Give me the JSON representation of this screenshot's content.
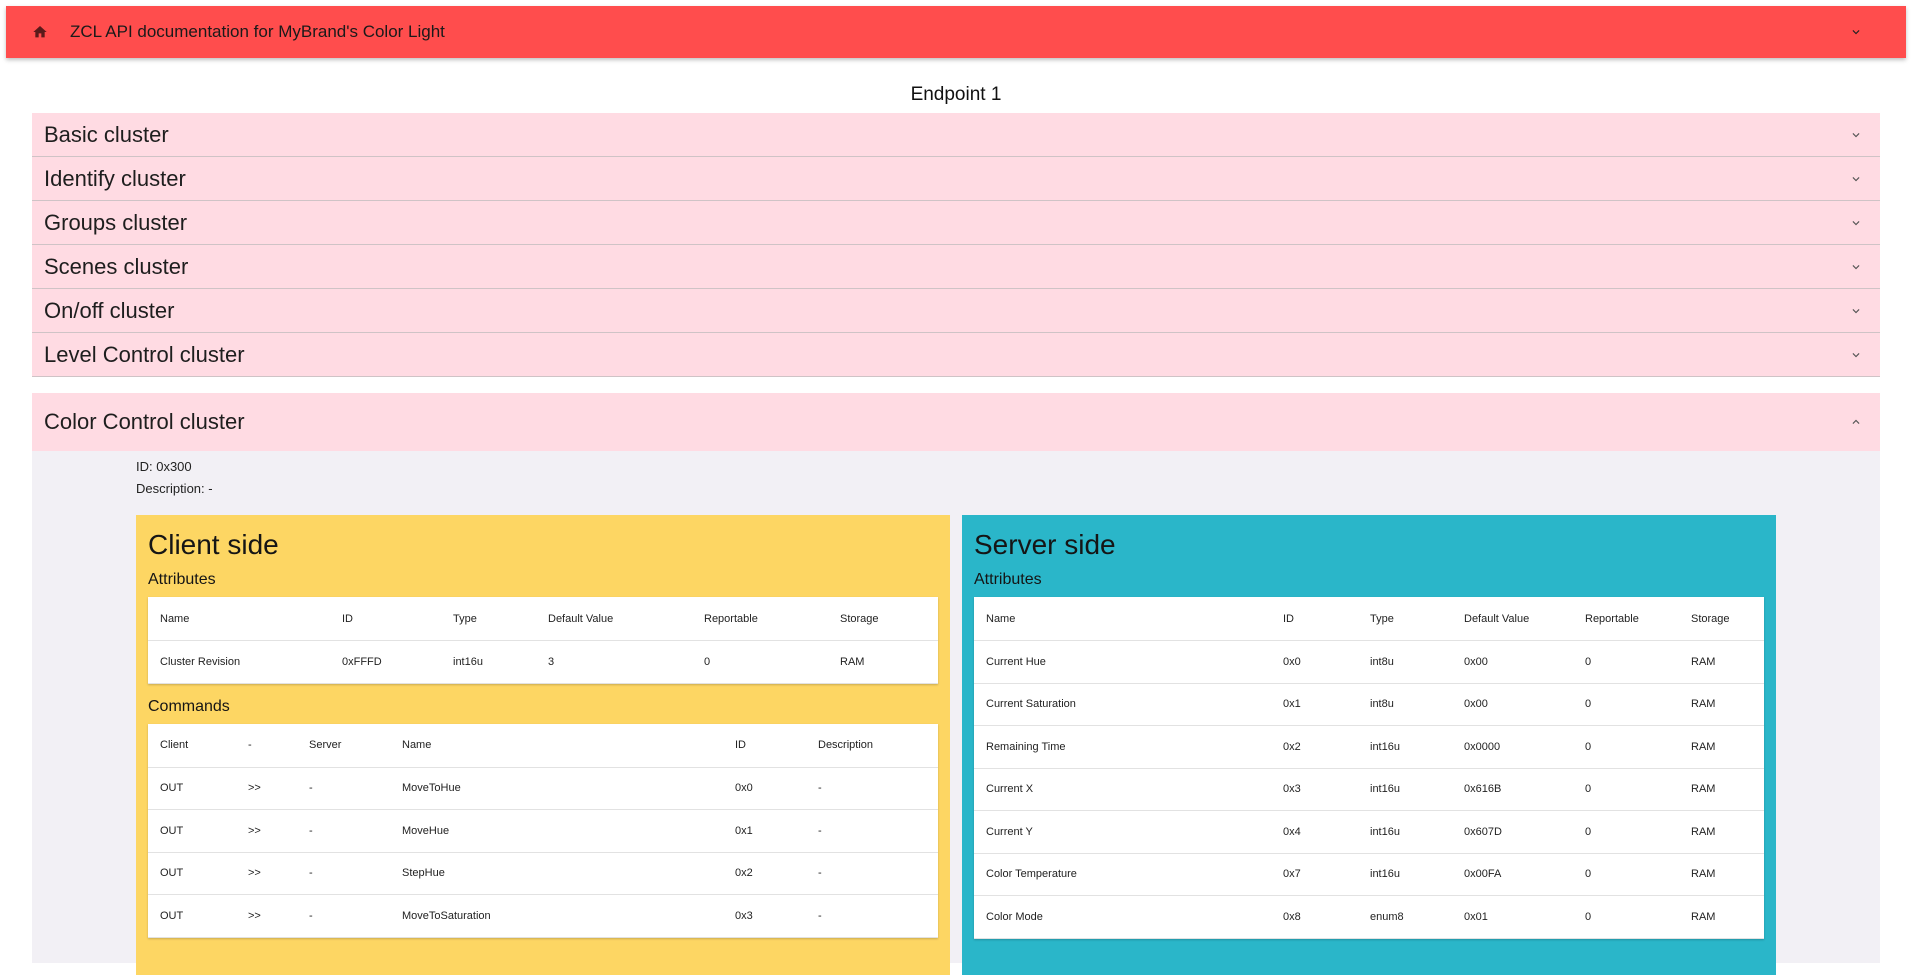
{
  "appbar": {
    "title": "ZCL API documentation for MyBrand's Color Light",
    "home_icon": "home-icon",
    "menu_icon": "chevron-down-icon"
  },
  "endpoint": {
    "title": "Endpoint 1"
  },
  "clusters": [
    {
      "name": "Basic cluster"
    },
    {
      "name": "Identify cluster"
    },
    {
      "name": "Groups cluster"
    },
    {
      "name": "Scenes cluster"
    },
    {
      "name": "On/off cluster"
    },
    {
      "name": "Level Control cluster"
    }
  ],
  "expanded_cluster": {
    "name": "Color Control cluster",
    "id_text": "ID: 0x300",
    "description_text": "Description: -",
    "client": {
      "title": "Client side",
      "attributes_label": "Attributes",
      "attr_headers": [
        "Name",
        "ID",
        "Type",
        "Default Value",
        "Reportable",
        "Storage"
      ],
      "attributes": [
        [
          "Cluster Revision",
          "0xFFFD",
          "int16u",
          "3",
          "0",
          "RAM"
        ]
      ],
      "commands_label": "Commands",
      "cmd_headers": [
        "Client",
        "-",
        "Server",
        "Name",
        "ID",
        "Description"
      ],
      "commands": [
        [
          "OUT",
          ">>",
          "-",
          "MoveToHue",
          "0x0",
          "-"
        ],
        [
          "OUT",
          ">>",
          "-",
          "MoveHue",
          "0x1",
          "-"
        ],
        [
          "OUT",
          ">>",
          "-",
          "StepHue",
          "0x2",
          "-"
        ],
        [
          "OUT",
          ">>",
          "-",
          "MoveToSaturation",
          "0x3",
          "-"
        ]
      ]
    },
    "server": {
      "title": "Server side",
      "attributes_label": "Attributes",
      "attr_headers": [
        "Name",
        "ID",
        "Type",
        "Default Value",
        "Reportable",
        "Storage"
      ],
      "attributes": [
        [
          "Current Hue",
          "0x0",
          "int8u",
          "0x00",
          "0",
          "RAM"
        ],
        [
          "Current Saturation",
          "0x1",
          "int8u",
          "0x00",
          "0",
          "RAM"
        ],
        [
          "Remaining Time",
          "0x2",
          "int16u",
          "0x0000",
          "0",
          "RAM"
        ],
        [
          "Current X",
          "0x3",
          "int16u",
          "0x616B",
          "0",
          "RAM"
        ],
        [
          "Current Y",
          "0x4",
          "int16u",
          "0x607D",
          "0",
          "RAM"
        ],
        [
          "Color Temperature",
          "0x7",
          "int16u",
          "0x00FA",
          "0",
          "RAM"
        ],
        [
          "Color Mode",
          "0x8",
          "enum8",
          "0x01",
          "0",
          "RAM"
        ]
      ]
    }
  },
  "colors": {
    "appbar": "#ff4d4d",
    "cluster_bg": "#ffdbe3",
    "client_bg": "#fdd663",
    "server_bg": "#2ab6c9"
  }
}
